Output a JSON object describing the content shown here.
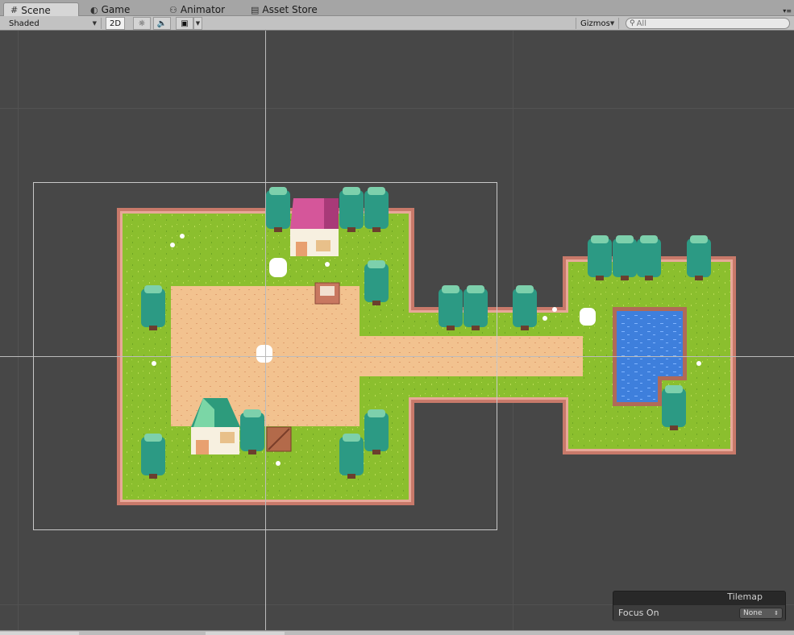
{
  "tabs": [
    {
      "label": "Scene",
      "icon": "grid-icon",
      "active": true
    },
    {
      "label": "Game",
      "icon": "pacman-icon",
      "active": false
    },
    {
      "label": "Animator",
      "icon": "animator-icon",
      "active": false
    },
    {
      "label": "Asset Store",
      "icon": "store-icon",
      "active": false
    }
  ],
  "toolbar": {
    "shading_mode": "Shaded",
    "mode_2d": "2D",
    "gizmos_label": "Gizmos",
    "search_placeholder": "All"
  },
  "tilemap_panel": {
    "title": "Tilemap",
    "focus_label": "Focus On",
    "focus_value": "None"
  },
  "colors": {
    "grass": "#8bbf2e",
    "dirt": "#f2c28f",
    "border": "#d49a8a",
    "water": "#3e7fdc",
    "tree": "#2c9a84",
    "roof_pink": "#d5569a",
    "roof_green": "#2d9b7c"
  }
}
